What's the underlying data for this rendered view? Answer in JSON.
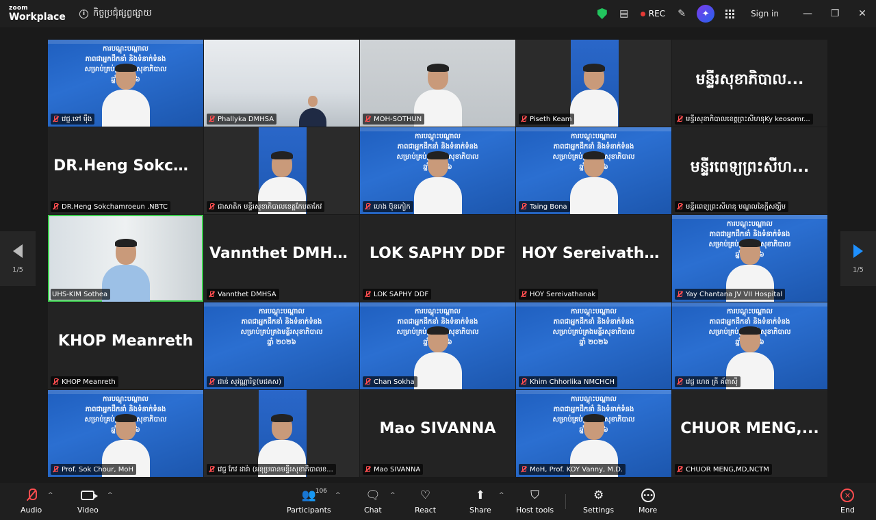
{
  "app": {
    "brand_top": "zoom",
    "brand_bottom": "Workplace",
    "meeting_title": "កិច្ចប្រជុំផ្សព្វផ្សាយ"
  },
  "titlebar": {
    "rec_label": "REC",
    "signin_label": "Sign in",
    "minimize": "—",
    "restore": "❐",
    "close": "✕"
  },
  "banner_text": "ការបណ្តុះបណ្តាល\nភាពជាអ្នកដឹកនាំ និងទំនាក់ទំនង\nសម្រាប់គ្រប់គ្រងមន្ទីរសុខាភិបាល\nឆ្នាំ ២០២៦",
  "pager": {
    "left": "1/5",
    "right": "1/5"
  },
  "tiles": [
    {
      "label": "វេជ្ជ.ទៅ ម៉ឹង",
      "kind": "banner-person",
      "muted": true
    },
    {
      "label": "Phallyka DMHSA",
      "kind": "room",
      "muted": true
    },
    {
      "label": "MOH-SOTHUN",
      "kind": "grey-person",
      "muted": true
    },
    {
      "label": "Piseth Keam",
      "kind": "strip-person",
      "muted": true
    },
    {
      "label": "មន្ទីរសុខាភិបាលខេត្តព្រះសីហនុKy keosomr...",
      "big": "មន្ទីរសុខាភិបាល...",
      "kind": "name",
      "muted": true
    },
    {
      "label": "DR.Heng Sokchamroeun .NBTC",
      "big": "DR.Heng  Sokcha...",
      "kind": "name",
      "muted": true
    },
    {
      "label": "ជាសាតិក មន្ទីរសុខាភិបាលខេត្តកែបតាកែវ",
      "kind": "strip-person",
      "muted": true
    },
    {
      "label": "ហេង ប៊ុនកៀក",
      "kind": "banner-person",
      "muted": true
    },
    {
      "label": "Taing Bona",
      "kind": "banner-person",
      "muted": true
    },
    {
      "label": "មន្ទីរពេទ្យព្រះសីហនុ មណ្ឌលនៃក្តីសង្ឃឹម",
      "big": "មន្ទីរពេទ្យព្រះសីហ...",
      "kind": "name",
      "muted": true
    },
    {
      "label": "UHS-KIM Sothea",
      "kind": "light-person",
      "muted": false,
      "active": true
    },
    {
      "label": "Vannthet DMHSA",
      "big": "Vannthet DMHSA",
      "kind": "name",
      "muted": true
    },
    {
      "label": "LOK SAPHY DDF",
      "big": "LOK SAPHY DDF",
      "kind": "name",
      "muted": true
    },
    {
      "label": "HOY Sereivathanak",
      "big": "HOY  Sereivathan...",
      "kind": "name",
      "muted": true
    },
    {
      "label": "Yay Chantana JV VII Hospital",
      "kind": "banner-person",
      "muted": true
    },
    {
      "label": "KHOP Meanreth",
      "big": "KHOP Meanreth",
      "kind": "name",
      "muted": true
    },
    {
      "label": "ជាន់ សុវណ្ណារិទ្ធ(មជគស)",
      "kind": "banner",
      "muted": true
    },
    {
      "label": "Chan Sokha",
      "kind": "banner-person",
      "muted": true
    },
    {
      "label": "Khim Chhorlika NMCHCH",
      "kind": "banner",
      "muted": true
    },
    {
      "label": "វេជ្ជ ហេត គ្រី គ័ពាសុី",
      "kind": "banner-person",
      "muted": true
    },
    {
      "label": "Prof. Sok Chour, MoH",
      "kind": "banner-person",
      "muted": true
    },
    {
      "label": "វេជ្ជ កែវ ដារ៉ា (អនុប្រធានមន្ទីរសុខាភិបាលខ...",
      "kind": "strip-person",
      "muted": true
    },
    {
      "label": "Mao SIVANNA",
      "big": "Mao SIVANNA",
      "kind": "name",
      "muted": true
    },
    {
      "label": "MoH, Prof. KOY Vanny, M.D.",
      "kind": "banner-person",
      "muted": true
    },
    {
      "label": "CHUOR MENG,MD,NCTM",
      "big": "CHUOR  MENG,...",
      "kind": "name",
      "muted": true
    }
  ],
  "toolbar": {
    "audio": "Audio",
    "video": "Video",
    "participants": "Participants",
    "participants_count": "106",
    "chat": "Chat",
    "react": "React",
    "share": "Share",
    "host_tools": "Host tools",
    "settings": "Settings",
    "more": "More",
    "end": "End"
  }
}
